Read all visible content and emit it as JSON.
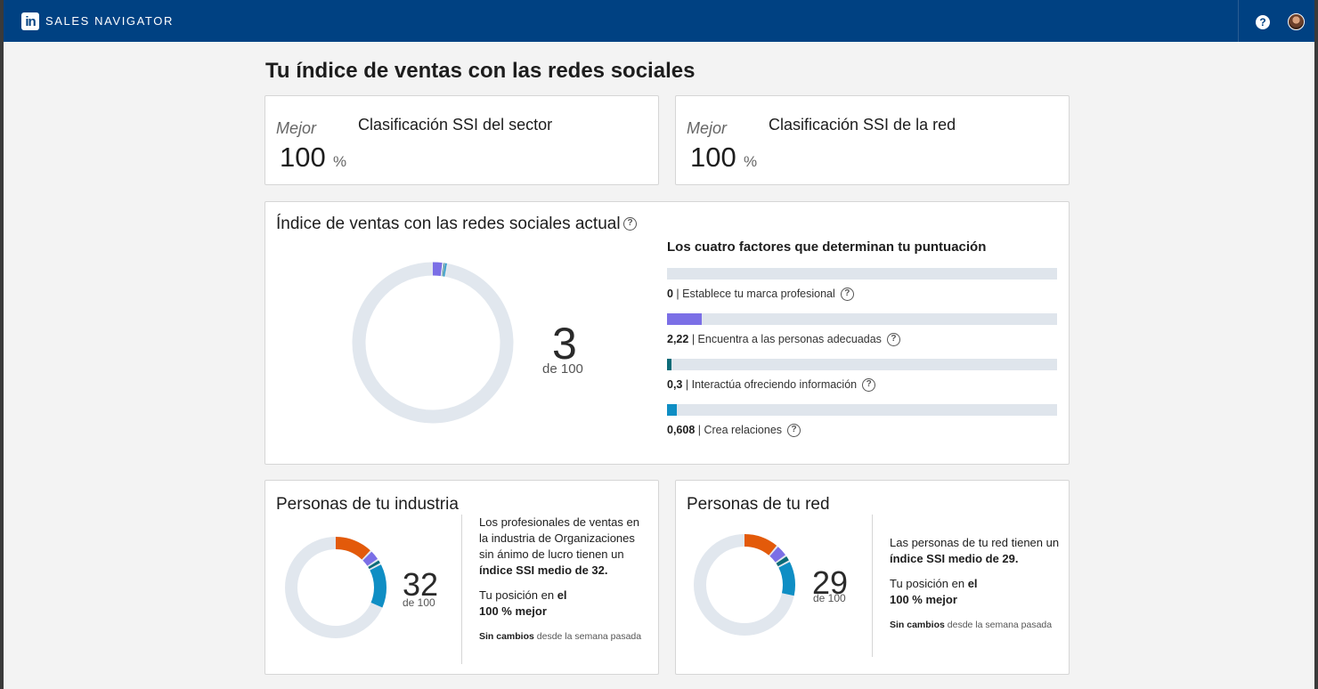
{
  "header": {
    "logo_text": "in",
    "brand": "SALES NAVIGATOR",
    "help_label": "?",
    "brand_color": "#004182"
  },
  "page_title": "Tu índice de ventas con las redes sociales",
  "rank_cards": [
    {
      "best_label": "Mejor",
      "value": "100",
      "unit": "%",
      "title": "Clasificación SSI del sector"
    },
    {
      "best_label": "Mejor",
      "value": "100",
      "unit": "%",
      "title": "Clasificación SSI de la red"
    }
  ],
  "ssi": {
    "title": "Índice de ventas con las redes sociales actual",
    "score": "3",
    "score_value": 3,
    "of_label": "de 100",
    "max": 100,
    "factors_title": "Los cuatro factores que determinan tu puntuación",
    "factors": [
      {
        "value": "0",
        "value_num": 0,
        "label": "Establece tu marca profesional",
        "color": "#7b6fe6"
      },
      {
        "value": "2,22",
        "value_num": 2.22,
        "label": "Encuentra a las personas adecuadas",
        "color": "#7b6fe6"
      },
      {
        "value": "0,3",
        "value_num": 0.3,
        "label": "Interactúa ofreciendo información",
        "color": "#0b6b78"
      },
      {
        "value": "0,608",
        "value_num": 0.608,
        "label": "Crea relaciones",
        "color": "#0f8ec4"
      }
    ],
    "factor_max": 25
  },
  "industry": {
    "title": "Personas de tu industria",
    "score": "32",
    "of_label": "de 100",
    "segments": [
      12.5,
      3.5,
      1.5,
      14.5
    ],
    "text_1": "Los profesionales de ventas en la industria de Organizaciones sin ánimo de lucro tienen un ",
    "text_1_bold": "índice SSI medio de 32.",
    "text_2": "Tu posición en ",
    "text_2_bold_a": "el",
    "text_2_bold_b": "100 % mejor",
    "change_bold": "Sin cambios",
    "change_rest": " desde la semana pasada"
  },
  "network": {
    "title": "Personas de tu red",
    "score": "29",
    "of_label": "de 100",
    "segments": [
      11.5,
      4,
      2,
      11.5
    ],
    "text_1": "Las personas de tu red tienen un ",
    "text_1_bold": "índice SSI medio de 29.",
    "text_2": "Tu posición en ",
    "text_2_bold_a": "el",
    "text_2_bold_b": "100 % mejor",
    "change_bold": "Sin cambios",
    "change_rest": " desde la semana pasada"
  },
  "segment_colors": [
    "#e35a0a",
    "#7b6fe6",
    "#0b6b78",
    "#0f8ec4"
  ],
  "track_color": "#e1e7ee"
}
